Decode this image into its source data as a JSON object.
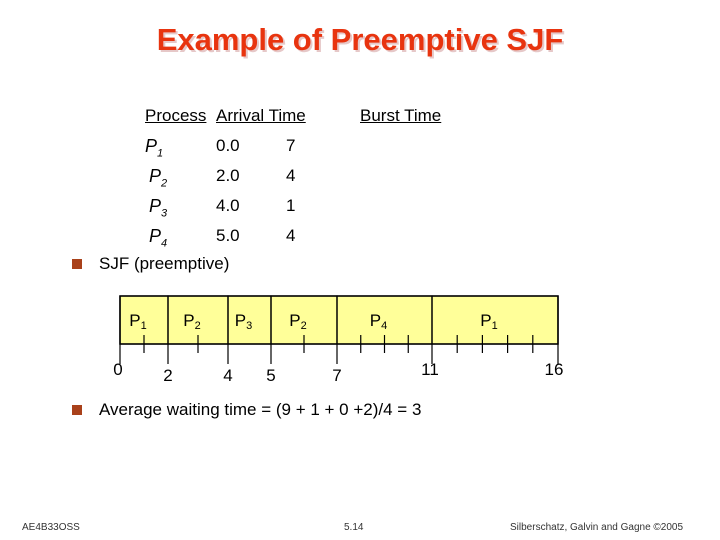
{
  "slide": {
    "title": "Example of Preemptive SJF",
    "table": {
      "headers": [
        "Process",
        "Arrival Time",
        "Burst Time"
      ],
      "rows": [
        {
          "process": "P",
          "sub": "1",
          "arrival": "0.0",
          "burst": "7"
        },
        {
          "process": "P",
          "sub": "2",
          "arrival": "2.0",
          "burst": "4"
        },
        {
          "process": "P",
          "sub": "3",
          "arrival": "4.0",
          "burst": "1"
        },
        {
          "process": "P",
          "sub": "4",
          "arrival": "5.0",
          "burst": "4"
        }
      ]
    },
    "bullets": [
      "SJF (preemptive)",
      "Average waiting time = (9 + 1 + 0 +2)/4 = 3"
    ],
    "footer": {
      "left": "AE4B33OSS",
      "center": "5.14",
      "right": "Silberschatz, Galvin and Gagne ©2005"
    },
    "colors": {
      "title": "#e8340f",
      "bullet": "#a9411a",
      "gantt_fill": "#ffff99"
    }
  },
  "chart_data": {
    "type": "gantt",
    "title": "SJF (preemptive)",
    "segments": [
      {
        "process": "P",
        "sub": "1",
        "start": 0,
        "end": 2
      },
      {
        "process": "P",
        "sub": "2",
        "start": 2,
        "end": 4
      },
      {
        "process": "P",
        "sub": "3",
        "start": 4,
        "end": 5
      },
      {
        "process": "P",
        "sub": "2",
        "start": 5,
        "end": 7
      },
      {
        "process": "P",
        "sub": "4",
        "start": 7,
        "end": 11
      },
      {
        "process": "P",
        "sub": "1",
        "start": 11,
        "end": 16
      }
    ],
    "boundary_labels": [
      "0",
      "2",
      "4",
      "5",
      "7",
      "11",
      "16"
    ],
    "boundaries": [
      0,
      2,
      4,
      5,
      7,
      11,
      16
    ],
    "unit_ticks": [
      1,
      3,
      6,
      8,
      9,
      10,
      12,
      13,
      14,
      15
    ],
    "xlim": [
      0,
      16
    ]
  }
}
